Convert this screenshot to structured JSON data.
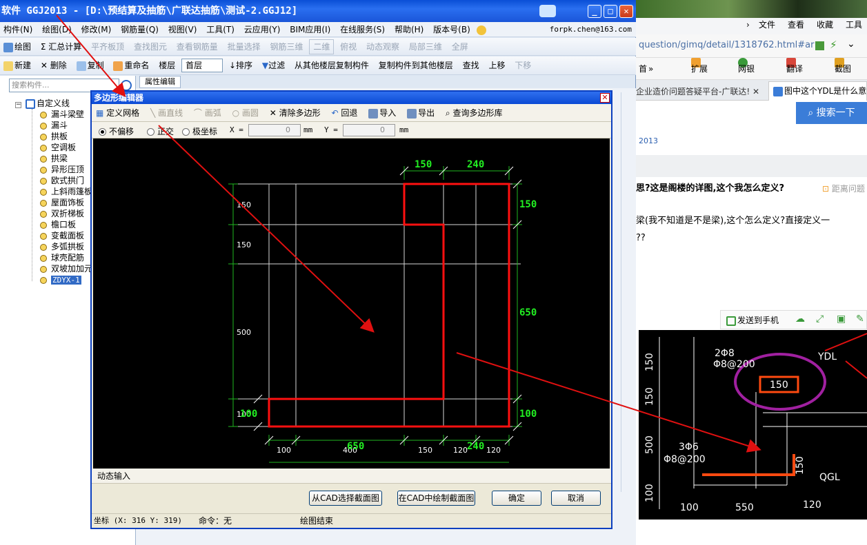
{
  "app": {
    "title": "软件 GGJ2013 - [D:\\预结算及抽筋\\广联达抽筋\\测试-2.GGJ12]",
    "window_buttons": {
      "minimize": "_",
      "maximize": "□",
      "close": "✕"
    },
    "menu": [
      "构件(N)",
      "绘图(D)",
      "修改(M)",
      "钢筋量(Q)",
      "视图(V)",
      "工具(T)",
      "云应用(Y)",
      "BIM应用(I)",
      "在线服务(S)",
      "帮助(H)",
      "版本号(B)"
    ],
    "user_email": "forpk.chen@163.com",
    "toolbar1": {
      "draw": "绘图",
      "summary": "汇总计算",
      "flush_board": "平齐板顶",
      "find_element": "查找图元",
      "view_rebar": "查看钢筋量",
      "batch_select": "批量选择",
      "rebar_3d": "钢筋三维",
      "view_mode": "二维",
      "top_view": "俯视",
      "dynamic_view": "动态观察",
      "local_3d": "局部三维",
      "fullscreen": "全屏"
    },
    "toolbar2": {
      "new": "新建",
      "delete": "删除",
      "copy": "复制",
      "rename": "重命名",
      "floor_label": "楼层",
      "floor_value": "首层",
      "sort": "排序",
      "filter": "过滤",
      "copy_from_floor": "从其他楼层复制构件",
      "copy_to_floor": "复制构件到其他楼层",
      "find": "查找",
      "move_up": "上移",
      "move_down": "下移"
    },
    "sidebar": {
      "search_placeholder": "搜索构件...",
      "root": "自定义线",
      "items": [
        "漏斗梁壁",
        "漏斗",
        "拱板",
        "空调板",
        "拱梁",
        "异形压顶",
        "欧式拱门",
        "上斜雨篷板",
        "屋面饰板",
        "双折梯板",
        "檐口板",
        "变截面板",
        "多弧拱板",
        "球壳配筋",
        "双坡加加元",
        "ZDYX-1"
      ],
      "prop_tab": "属性编辑"
    }
  },
  "dialog": {
    "title": "多边形编辑器",
    "close": "✕",
    "tools": {
      "define_grid": "定义网格",
      "draw_line": "画直线",
      "draw_arc": "画弧",
      "draw_circle": "画圆",
      "clear_polygon": "清除多边形",
      "undo": "回退",
      "import": "导入",
      "export": "导出",
      "query_library": "查询多边形库"
    },
    "options": {
      "no_offset": "不偏移",
      "orthogonal": "正交",
      "polar": "极坐标",
      "x_label": "X =",
      "x_value": "0",
      "y_label": "Y =",
      "y_value": "0",
      "unit": "mm"
    },
    "dims": {
      "top": [
        "150",
        "240"
      ],
      "left": [
        "150",
        "150",
        "500",
        "100"
      ],
      "right": [
        "150",
        "650",
        "100"
      ],
      "bottom_white": [
        "100",
        "400",
        "150",
        "120",
        "120"
      ],
      "bottom_green": [
        "650",
        "240"
      ],
      "left_green": "100"
    },
    "dynamic_input": "动态输入",
    "buttons": {
      "select_cad": "从CAD选择截面图",
      "draw_cad": "在CAD中绘制截面图",
      "ok": "确定",
      "cancel": "取消"
    },
    "status": {
      "coord": "坐标 (X: 316 Y: 319)",
      "command": "命令：无",
      "state": "绘图结束"
    }
  },
  "browser": {
    "menu": [
      "文件",
      "查看",
      "收藏",
      "工具"
    ],
    "url": "question/gimq/detail/1318762.html#ar",
    "ext": [
      "扩展",
      "网银",
      "翻译",
      "截图"
    ],
    "tab_a": "企业造价问题答疑平台-广联达!",
    "tab_b": "图中这个YDL是什么意思",
    "search_btn": "搜索一下",
    "crumb": "2013",
    "question_title": "思?这是阁楼的详图,这个我怎么定义?",
    "deadline": "距离问题",
    "body_line1": "梁(我不知道是不是梁),这个怎么定义?直接定义一",
    "body_line2": "??",
    "send_phone": "发送到手机",
    "img_labels": {
      "top_note1": "2Φ8",
      "top_note2": "Φ8@200",
      "ydl": "YDL",
      "mid_note1": "3Φ6",
      "mid_note2": "Φ8@200",
      "qgl": "QGL",
      "v150a": "150",
      "v150b": "150",
      "v500": "500",
      "v100": "100",
      "h100": "100",
      "h550": "550",
      "h120": "120",
      "inner150": "150",
      "inner150b": "150"
    }
  },
  "colors": {
    "canvas_bg": "#000000",
    "polygon": "#ff1010",
    "dim_green": "#22ee22",
    "grid": "#ffffff",
    "arrow": "#e01010",
    "title_blue": "#0b4ad4"
  }
}
